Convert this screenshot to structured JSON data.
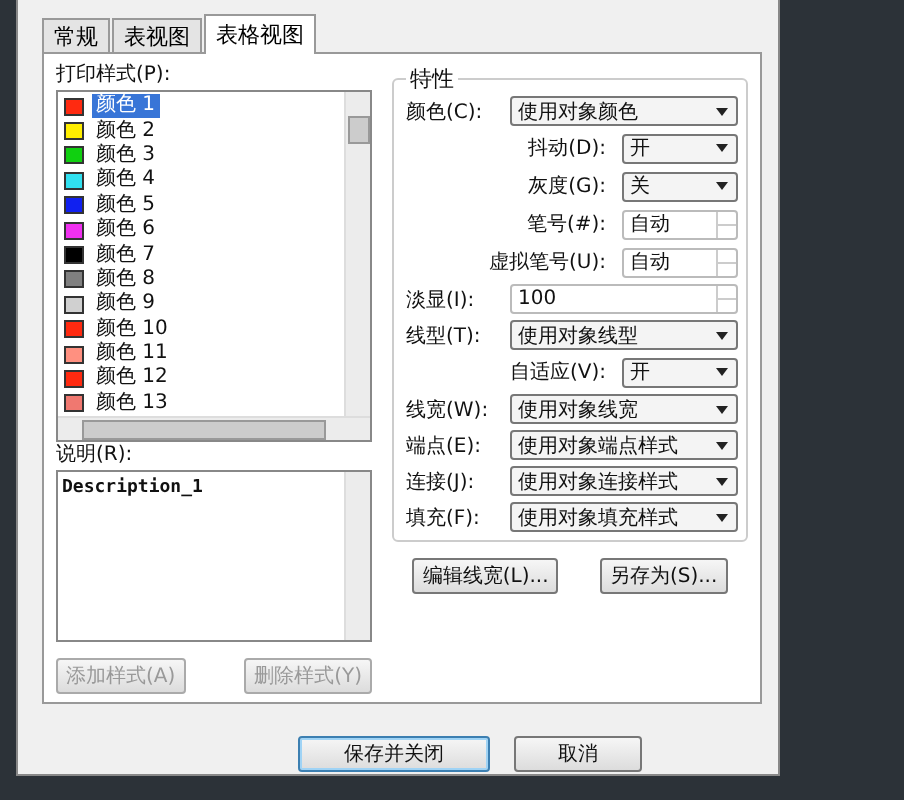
{
  "tabs": [
    {
      "label": "常规",
      "selected": false
    },
    {
      "label": "表视图",
      "selected": false
    },
    {
      "label": "表格视图",
      "selected": true
    }
  ],
  "styles": {
    "label": "打印样式(P):",
    "items": [
      {
        "name": "颜色 1",
        "color": "#ff2a10",
        "selected": true
      },
      {
        "name": "颜色 2",
        "color": "#ffee00",
        "selected": false
      },
      {
        "name": "颜色 3",
        "color": "#10d010",
        "selected": false
      },
      {
        "name": "颜色 4",
        "color": "#30e0f0",
        "selected": false
      },
      {
        "name": "颜色 5",
        "color": "#1020f0",
        "selected": false
      },
      {
        "name": "颜色 6",
        "color": "#f030f0",
        "selected": false
      },
      {
        "name": "颜色 7",
        "color": "#000000",
        "selected": false
      },
      {
        "name": "颜色 8",
        "color": "#808080",
        "selected": false
      },
      {
        "name": "颜色 9",
        "color": "#d0d0d0",
        "selected": false
      },
      {
        "name": "颜色 10",
        "color": "#ff2a10",
        "selected": false
      },
      {
        "name": "颜色 11",
        "color": "#ff9080",
        "selected": false
      },
      {
        "name": "颜色 12",
        "color": "#ff2a10",
        "selected": false
      },
      {
        "name": "颜色 13",
        "color": "#f07870",
        "selected": false
      }
    ]
  },
  "description": {
    "label": "说明(R):",
    "value": "Description_1"
  },
  "style_buttons": [
    {
      "label": "添加样式(A)",
      "disabled": true
    },
    {
      "label": "删除样式(Y)",
      "disabled": true
    }
  ],
  "properties": {
    "title": "特性",
    "rows": [
      {
        "label": "颜色(C):",
        "value": "使用对象颜色",
        "kind": "select"
      },
      {
        "label": "抖动(D):",
        "value": "开",
        "kind": "short-select"
      },
      {
        "label": "灰度(G):",
        "value": "关",
        "kind": "short-select"
      },
      {
        "label": "笔号(#):",
        "value": "自动",
        "kind": "short-spin"
      },
      {
        "label": "虚拟笔号(U):",
        "value": "自动",
        "kind": "short-spin"
      },
      {
        "label": "淡显(I):",
        "value": "100",
        "kind": "spin"
      },
      {
        "label": "线型(T):",
        "value": "使用对象线型",
        "kind": "select"
      },
      {
        "label": "自适应(V):",
        "value": "开",
        "kind": "short-select"
      },
      {
        "label": "线宽(W):",
        "value": "使用对象线宽",
        "kind": "select"
      },
      {
        "label": "端点(E):",
        "value": "使用对象端点样式",
        "kind": "select"
      },
      {
        "label": "连接(J):",
        "value": "使用对象连接样式",
        "kind": "select"
      },
      {
        "label": "填充(F):",
        "value": "使用对象填充样式",
        "kind": "select"
      }
    ],
    "buttons": [
      {
        "label": "编辑线宽(L)...",
        "disabled": false
      },
      {
        "label": "另存为(S)...",
        "disabled": false
      }
    ]
  },
  "footer_buttons": [
    {
      "label": "保存并关闭",
      "default": true
    },
    {
      "label": "取消",
      "default": false
    }
  ]
}
